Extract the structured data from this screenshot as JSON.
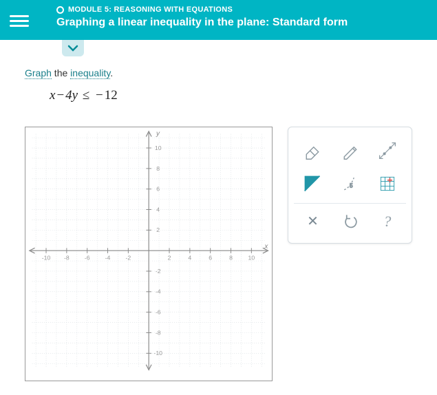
{
  "header": {
    "module_label": "MODULE 5: REASONING WITH EQUATIONS",
    "lesson_title": "Graphing a linear inequality in the plane: Standard form"
  },
  "instruction": {
    "word_graph": "Graph",
    "mid": " the ",
    "word_inequality": "inequality",
    "end": "."
  },
  "inequality": {
    "lhs_a": "x",
    "op1": "−",
    "lhs_b": "4y",
    "rel": "≤",
    "op2": "−",
    "rhs": "12"
  },
  "graph": {
    "x_label": "x",
    "y_label": "y",
    "ticks_neg": [
      "-10",
      "-8",
      "-6",
      "-4",
      "-2"
    ],
    "ticks_pos": [
      "2",
      "4",
      "6",
      "8",
      "10"
    ]
  },
  "tools": {
    "eraser": "eraser",
    "pencil": "pencil",
    "line": "line-2pt",
    "fill_region": "fill-region",
    "dashed_curve": "dashed-boundary",
    "grid_snap": "grid-snap",
    "clear": "clear",
    "undo": "undo",
    "help": "help"
  }
}
